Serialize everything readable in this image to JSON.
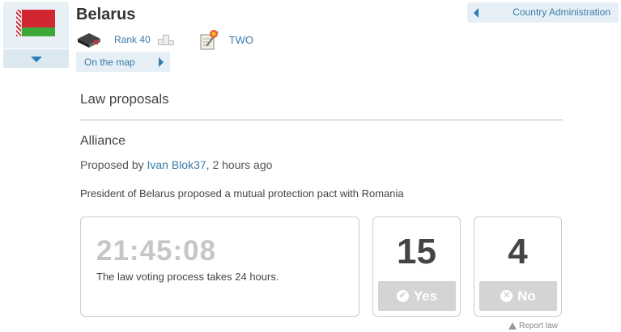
{
  "country": {
    "name": "Belarus",
    "rank_label": "Rank 40",
    "party_label": "TWO",
    "on_map_label": "On the map",
    "admin_label": "Country Administration"
  },
  "colors": {
    "accent": "#3a7ca8",
    "flag_red": "#d22730",
    "flag_green": "#3da83a"
  },
  "icons": {
    "flag": "belarus-flag-icon",
    "toggle": "chevron-down-icon",
    "rank": "book-icon",
    "podium": "podium-icon",
    "party": "law-scroll-icon",
    "map": "chevron-right-icon",
    "admin": "chevron-left-icon",
    "yes": "check-circle-icon",
    "no": "x-circle-icon",
    "report": "warning-icon"
  },
  "section": {
    "title": "Law proposals"
  },
  "law": {
    "title": "Alliance",
    "proposed_prefix": "Proposed by ",
    "proposer": "Ivan Blok37",
    "proposed_suffix": ", 2 hours ago",
    "description": "President of Belarus proposed a mutual protection pact with Romania",
    "timer": "21:45:08",
    "timer_note": "The law voting process takes 24 hours.",
    "yes_count": "15",
    "yes_label": "Yes",
    "no_count": "4",
    "no_label": "No",
    "report_label": "Report law"
  }
}
